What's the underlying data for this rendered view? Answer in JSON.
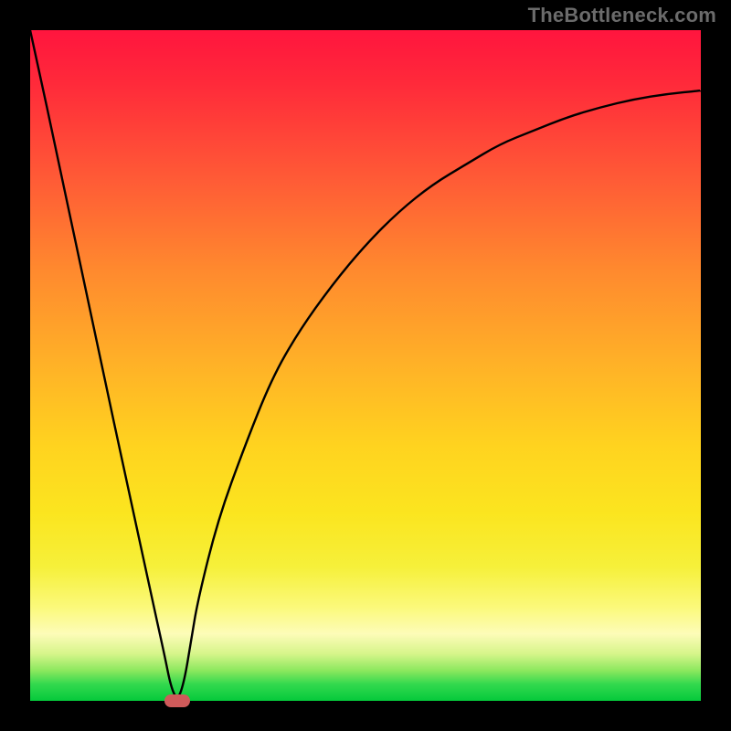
{
  "watermark": "TheBottleneck.com",
  "colors": {
    "background": "#000000",
    "gradient_top": "#ff153e",
    "gradient_bottom": "#05c93b",
    "curve": "#000000",
    "marker": "#cf5a5a"
  },
  "chart_data": {
    "type": "line",
    "title": "",
    "xlabel": "",
    "ylabel": "",
    "xlim": [
      0,
      100
    ],
    "ylim": [
      0,
      100
    ],
    "grid": false,
    "legend": false,
    "x": [
      0,
      5,
      10,
      15,
      18,
      20,
      21,
      22,
      23,
      24,
      25,
      28,
      32,
      36,
      40,
      45,
      50,
      55,
      60,
      65,
      70,
      75,
      80,
      85,
      90,
      95,
      100
    ],
    "y": [
      100,
      77,
      53,
      30,
      16,
      7,
      2,
      0,
      3,
      9,
      15,
      27,
      38,
      48,
      55,
      62,
      68,
      73,
      77,
      80,
      83,
      85,
      87,
      88.5,
      89.7,
      90.5,
      91
    ],
    "note": "x is normalized horizontal position (0=left edge of plot, 100=right edge); y is normalized value (0=bottom green, 100=top red). V-shaped curve reaching minimum ~0 at x≈22 then rising with diminishing slope to ~91 at right edge.",
    "marker": {
      "x": 22,
      "y": 0,
      "shape": "rounded-rect",
      "color": "#cf5a5a"
    }
  }
}
